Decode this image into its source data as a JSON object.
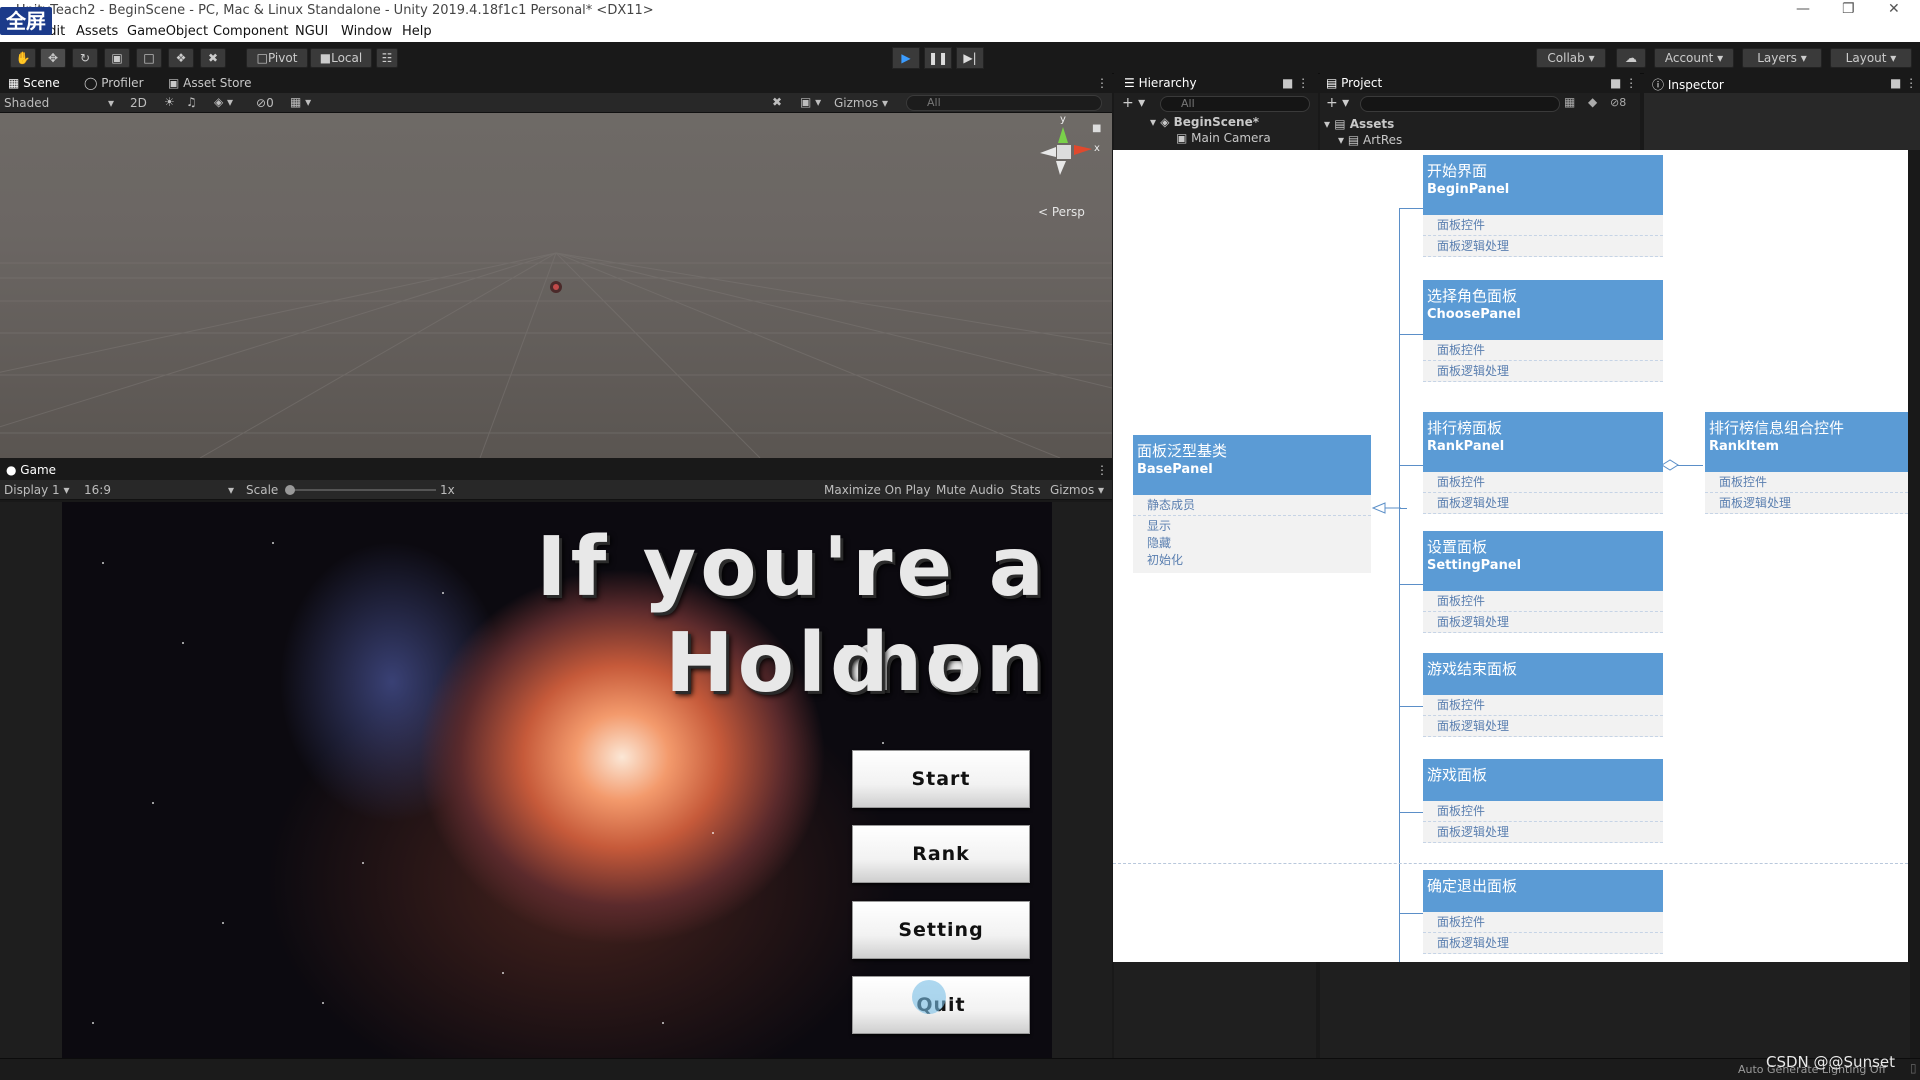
{
  "window": {
    "title": "UnityTeach2 - BeginScene - PC, Mac & Linux Standalone - Unity 2019.4.18f1c1 Personal* <DX11>",
    "fullscreen_badge": "全屏"
  },
  "menu": [
    "File",
    "Edit",
    "Assets",
    "GameObject",
    "Component",
    "NGUI",
    "Window",
    "Help"
  ],
  "toolbar": {
    "pivot_label": "Pivot",
    "local_label": "Local",
    "collab_label": "Collab",
    "account_label": "Account",
    "layers_label": "Layers",
    "layout_label": "Layout"
  },
  "scene": {
    "tabs": [
      "Scene",
      "Profiler",
      "Asset Store"
    ],
    "shading": "Shaded",
    "mode_2d": "2D",
    "hidden_count": "0",
    "gizmos_label": "Gizmos",
    "search_placeholder": "All",
    "persp_label": "Persp",
    "axis_y": "y",
    "axis_x": "x"
  },
  "game": {
    "tab": "Game",
    "display": "Display 1",
    "aspect": "16:9",
    "scale_label": "Scale",
    "scale_value": "1x",
    "maximize": "Maximize On Play",
    "mute": "Mute Audio",
    "stats": "Stats",
    "gizmos": "Gizmos",
    "title_line1": "If you're a man",
    "title_line2": "Hold on",
    "buttons": [
      "Start",
      "Rank",
      "Setting",
      "Quit"
    ]
  },
  "hierarchy": {
    "tab": "Hierarchy",
    "search_placeholder": "All",
    "scene_name": "BeginScene*",
    "items": [
      "Main Camera"
    ]
  },
  "project": {
    "tab": "Project",
    "hidden_count": "8",
    "root": "Assets",
    "items": [
      "ArtRes"
    ]
  },
  "inspector": {
    "tab": "Inspector"
  },
  "diagram": {
    "base": {
      "cn": "面板泛型基类",
      "en": "BasePanel",
      "section": "静态成员",
      "methods": [
        "显示",
        "隐藏",
        "初始化"
      ]
    },
    "panels": [
      {
        "cn": "开始界面",
        "en": "BeginPanel",
        "rows": [
          "面板控件",
          "面板逻辑处理"
        ]
      },
      {
        "cn": "选择角色面板",
        "en": "ChoosePanel",
        "rows": [
          "面板控件",
          "面板逻辑处理"
        ]
      },
      {
        "cn": "排行榜面板",
        "en": "RankPanel",
        "rows": [
          "面板控件",
          "面板逻辑处理"
        ]
      },
      {
        "cn": "设置面板",
        "en": "SettingPanel",
        "rows": [
          "面板控件",
          "面板逻辑处理"
        ]
      },
      {
        "cn": "游戏结束面板",
        "en": "",
        "rows": [
          "面板控件",
          "面板逻辑处理"
        ]
      },
      {
        "cn": "游戏面板",
        "en": "",
        "rows": [
          "面板控件",
          "面板逻辑处理"
        ]
      },
      {
        "cn": "确定退出面板",
        "en": "",
        "rows": [
          "面板控件",
          "面板逻辑处理"
        ]
      }
    ],
    "rank_item": {
      "cn": "排行榜信息组合控件",
      "en": "RankItem",
      "rows": [
        "面板控件",
        "面板逻辑处理"
      ]
    }
  },
  "status": {
    "lighting": "Auto Generate Lighting Off",
    "watermark": "CSDN @@Sunset"
  }
}
